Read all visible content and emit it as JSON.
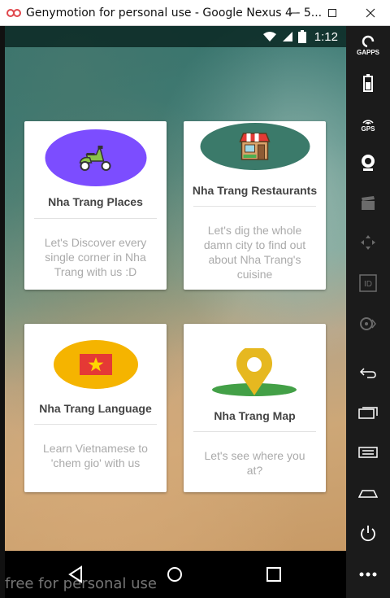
{
  "window": {
    "title": "Genymotion for personal use - Google Nexus 4 - 5..."
  },
  "status_bar": {
    "time": "1:12"
  },
  "cards": [
    {
      "title": "Nha Trang Places",
      "description": "Let's Discover every single corner in Nha Trang with us :D",
      "icon": "scooter-icon",
      "color": "#7c4dff"
    },
    {
      "title": "Nha Trang Restaurants",
      "description": "Let's dig the whole damn city to find out about Nha Trang's cuisine",
      "icon": "shop-icon",
      "color": "#3b7a6a"
    },
    {
      "title": "Nha Trang Language",
      "description": "Learn Vietnamese to 'chem gio' with us",
      "icon": "vietnam-flag-icon",
      "color": "#f5b400"
    },
    {
      "title": "Nha Trang Map",
      "description": "Let's see where you at?",
      "icon": "map-pin-icon",
      "color": "#e6b820"
    }
  ],
  "sidebar": {
    "gapps_label": "GAPPS",
    "gps_label": "GPS",
    "id_label": "ID"
  },
  "watermark": "free for personal use"
}
